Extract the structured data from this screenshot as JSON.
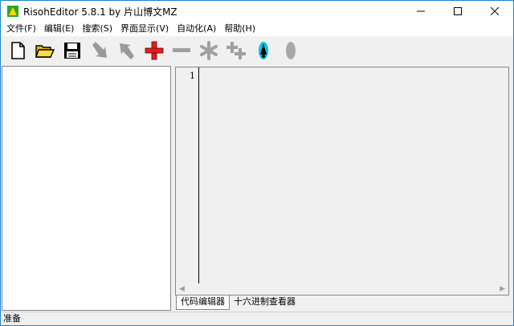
{
  "window": {
    "title": "RisohEditor 5.8.1 by 片山博文MZ"
  },
  "menu": [
    {
      "label": "文件(F)"
    },
    {
      "label": "编辑(E)"
    },
    {
      "label": "搜索(S)"
    },
    {
      "label": "界面显示(V)"
    },
    {
      "label": "自动化(A)"
    },
    {
      "label": "帮助(H)"
    }
  ],
  "toolbar": {
    "buttons": [
      {
        "icon": "new-file-icon"
      },
      {
        "icon": "open-folder-icon"
      },
      {
        "icon": "save-disk-icon"
      },
      {
        "icon": "import-arrow-icon"
      },
      {
        "icon": "export-arrow-icon"
      },
      {
        "icon": "add-plus-icon"
      },
      {
        "icon": "delete-minus-icon"
      },
      {
        "icon": "modify-asterisk-icon"
      },
      {
        "icon": "copy-plus-icon"
      },
      {
        "icon": "compile-rocket-icon"
      },
      {
        "icon": "test-ellipse-icon"
      }
    ]
  },
  "editor": {
    "line_number": "1",
    "tabs": [
      "代码编辑器",
      "十六进制查看器"
    ]
  },
  "status": {
    "text": "准备"
  },
  "colors": {
    "accent": "#1883d7",
    "plus_red": "#e02020",
    "rocket_cyan": "#00c8e6"
  }
}
